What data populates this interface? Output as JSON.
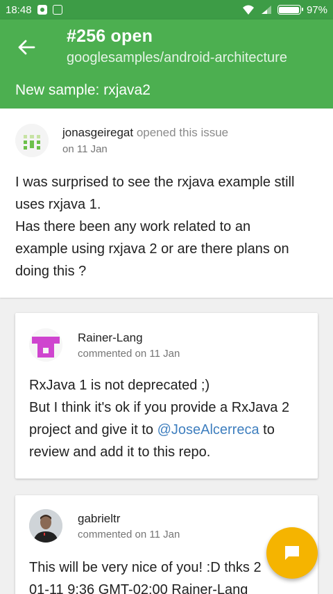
{
  "status_bar": {
    "time": "18:48",
    "battery": "97%",
    "battery_level": 0.97
  },
  "header": {
    "issue_number": "#256 open",
    "repo": "googlesamples/android-architecture",
    "title": "New sample: rxjava2"
  },
  "issue": {
    "author": "jonasgeiregat",
    "action": "opened this issue",
    "date": "on 11 Jan",
    "body": [
      "I was surprised to see the rxjava example still",
      "uses rxjava 1.",
      "Has there been any work related to an",
      "example using rxjava 2 or are there plans on",
      "doing this ?"
    ]
  },
  "comments": [
    {
      "author": "Rainer-Lang",
      "meta": "commented on 11 Jan",
      "line1": "RxJava 1 is not deprecated ;)",
      "line2": "But I think it's ok if you provide a RxJava 2",
      "line3_before": "project and give it to ",
      "mention": "@JoseAlcerreca",
      "line3_after": " to",
      "line4": "review and add it to this repo."
    },
    {
      "author": "gabrieltr",
      "meta": "commented on 11 Jan",
      "line1": "This will be very nice of you! :D thks 2",
      "line2": "01-11 9:36 GMT-02:00 Rainer-Lang"
    }
  ],
  "colors": {
    "status_bar": "#3d9c46",
    "header": "#4caf50",
    "fab": "#f5b400",
    "link": "#3f7fbf"
  }
}
